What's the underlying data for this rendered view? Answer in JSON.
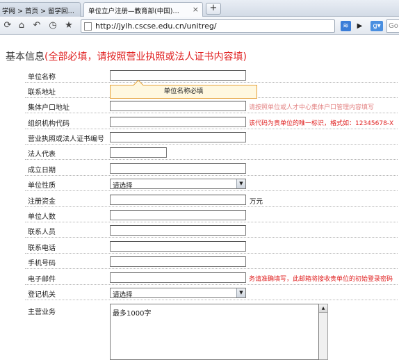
{
  "browser": {
    "tabs": [
      {
        "label": "学网 > 首页 > 留学回…",
        "active": false
      },
      {
        "label": "单位立户注册—教育部(中国)…",
        "active": true
      }
    ],
    "tab_close": "×",
    "new_tab": "+",
    "url": "http://jylh.cscse.edu.cn/unitreg/",
    "search_placeholder": "Go",
    "icons": [
      "reload-icon",
      "home-icon",
      "undo-icon",
      "history-icon",
      "star-icon"
    ]
  },
  "form": {
    "section_title": "基本信息",
    "section_note": "(全部必填，请按照营业执照或法人证书内容填)",
    "tooltip": "单位名称必填",
    "fields": {
      "unit_name": {
        "label": "单位名称",
        "value": ""
      },
      "address": {
        "label": "联系地址",
        "value": ""
      },
      "collective_address": {
        "label": "集体户口地址",
        "value": "",
        "hint": "请按照单位或人才中心集体户口管理内容填写"
      },
      "org_code": {
        "label": "组织机构代码",
        "value": "",
        "hint": "该代码为贵单位的唯一标识，格式如：12345678-X"
      },
      "license_no": {
        "label": "营业执照或法人证书编号",
        "value": ""
      },
      "legal_rep": {
        "label": "法人代表",
        "value": ""
      },
      "founded": {
        "label": "成立日期",
        "value": ""
      },
      "unit_type": {
        "label": "单位性质",
        "selected": "请选择"
      },
      "capital": {
        "label": "注册资金",
        "value": "",
        "unit": "万元"
      },
      "staff_count": {
        "label": "单位人数",
        "value": ""
      },
      "contact": {
        "label": "联系人员",
        "value": ""
      },
      "phone": {
        "label": "联系电话",
        "value": ""
      },
      "mobile": {
        "label": "手机号码",
        "value": ""
      },
      "email": {
        "label": "电子邮件",
        "value": "",
        "hint": "务请准确填写，此邮箱将接收贵单位的初始登录密码"
      },
      "reg_authority": {
        "label": "登记机关",
        "selected": "请选择"
      },
      "main_business": {
        "label": "主营业务",
        "value": "最多1000字"
      }
    }
  },
  "colors": {
    "required_red": "#e02020",
    "tooltip_bg": "#fff8e0",
    "tooltip_border": "#e5a23a"
  }
}
